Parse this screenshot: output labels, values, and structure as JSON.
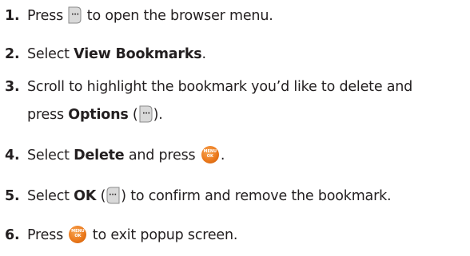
{
  "steps": [
    {
      "number": "1.",
      "before": "Press ",
      "icon": "right-softkey-icon",
      "after": " to open the browser menu."
    },
    {
      "number": "2.",
      "before": "Select ",
      "bold": "View Bookmarks",
      "after": "."
    },
    {
      "number": "3.",
      "line1": "Scroll to highlight the bookmark you’d like to delete and",
      "line2_before": "press ",
      "bold": "Options",
      "line2_paren_open": " (",
      "icon": "right-softkey-icon",
      "line2_after": ")."
    },
    {
      "number": "4.",
      "before": "Select ",
      "bold": "Delete",
      "middle": " and press ",
      "icon": "menu-ok-button-icon",
      "after": "."
    },
    {
      "number": "5.",
      "before": "Select ",
      "bold": "OK",
      "paren_open": " (",
      "icon": "left-softkey-icon",
      "after": ") to confirm and remove the bookmark."
    },
    {
      "number": "6.",
      "before": "Press ",
      "icon": "menu-ok-button-icon",
      "after": " to exit popup screen."
    }
  ],
  "menu_ok_icon": {
    "top_text": "MENU",
    "bottom_text": "OK",
    "color": "#ec7a1c"
  },
  "softkey_icon": {
    "color": "#d9d9d9",
    "dots": "···"
  },
  "colors": {
    "text": "#231f20",
    "number": "#231f20"
  }
}
